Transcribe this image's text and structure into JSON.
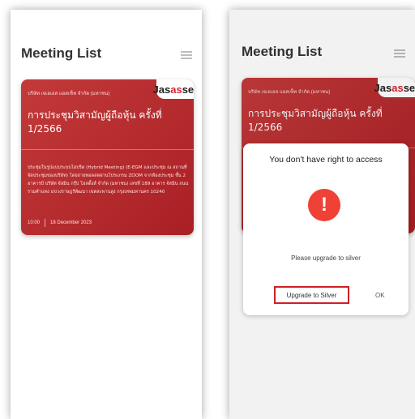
{
  "header": {
    "title": "Meeting List",
    "menu_icon": "hamburger-menu-icon"
  },
  "card": {
    "company": "บริษัท เจเอเอส แอสเซ็ท จำกัด (มหาชน)",
    "logo_top": "Jas",
    "logo_bottom": "asset",
    "title": "การประชุมวิสามัญผู้ถือหุ้น ครั้งที่ 1/2566",
    "description": "ประชุมในรูปแบบระบบไฮบริด (Hybrid Meeting) (E-EGM และประชุม ณ สถานที่จัดประชุมของบริษัท) โดยถ่ายทอดสดผ่านโปรแกรม ZOOM จากห้องประชุม ชั้น 2 อาคารบี บริษัท จัสมิน กรุ๊ป โฮลดิ้งส์ จำกัด (มหาชน) เลขที่ 189 อาคาร จัสมิน ถนนรามคำแหง แขวงราษฎร์พัฒนา เขตสะพานสูง กรุงเทพมหานคร 10240",
    "time": "10:00",
    "date": "18 December 2023"
  },
  "dialog": {
    "title": "You don't have right to access",
    "icon": "exclamation-alert-icon",
    "message": "Please upgrade to silver",
    "upgrade_label": "Upgrade to Silver",
    "ok_label": "OK"
  },
  "colors": {
    "card_red": "#b8282c",
    "alert_red": "#ef4136",
    "highlight_border": "#d01f26"
  }
}
